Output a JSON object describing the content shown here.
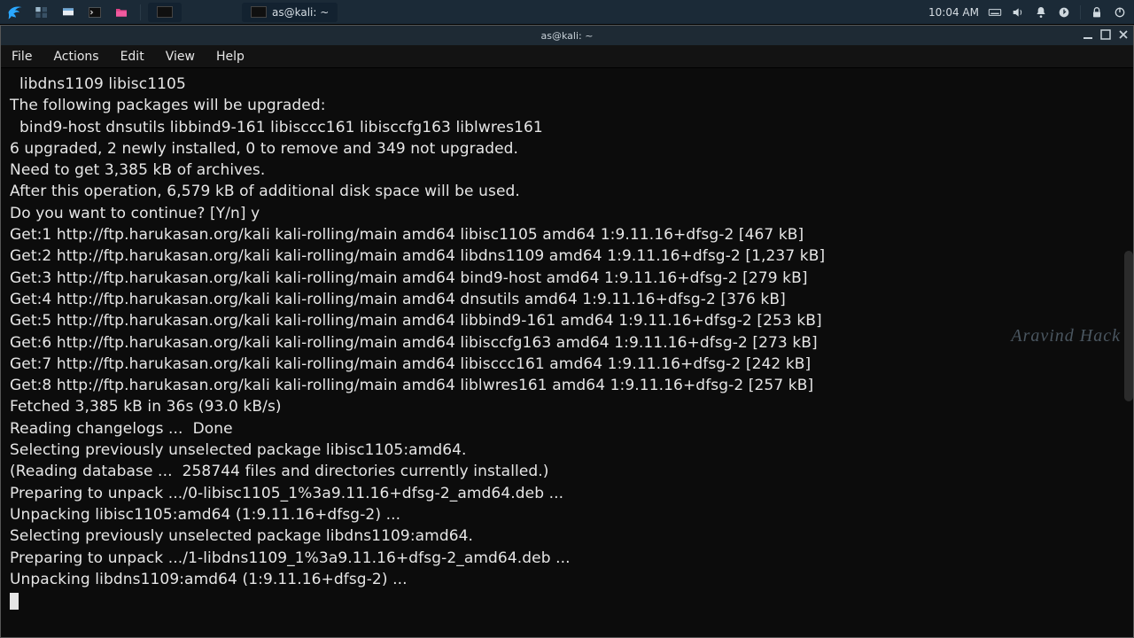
{
  "panel": {
    "taskbar": {
      "title": "as@kali: ~"
    },
    "clock": "10:04 AM"
  },
  "window": {
    "title": "as@kali: ~",
    "menus": [
      "File",
      "Actions",
      "Edit",
      "View",
      "Help"
    ]
  },
  "watermark": "Aravind Hack",
  "terminal": {
    "lines": [
      "  libdns1109 libisc1105",
      "The following packages will be upgraded:",
      "  bind9-host dnsutils libbind9-161 libisccc161 libisccfg163 liblwres161",
      "6 upgraded, 2 newly installed, 0 to remove and 349 not upgraded.",
      "Need to get 3,385 kB of archives.",
      "After this operation, 6,579 kB of additional disk space will be used.",
      "Do you want to continue? [Y/n] y",
      "Get:1 http://ftp.harukasan.org/kali kali-rolling/main amd64 libisc1105 amd64 1:9.11.16+dfsg-2 [467 kB]",
      "Get:2 http://ftp.harukasan.org/kali kali-rolling/main amd64 libdns1109 amd64 1:9.11.16+dfsg-2 [1,237 kB]",
      "Get:3 http://ftp.harukasan.org/kali kali-rolling/main amd64 bind9-host amd64 1:9.11.16+dfsg-2 [279 kB]",
      "Get:4 http://ftp.harukasan.org/kali kali-rolling/main amd64 dnsutils amd64 1:9.11.16+dfsg-2 [376 kB]",
      "Get:5 http://ftp.harukasan.org/kali kali-rolling/main amd64 libbind9-161 amd64 1:9.11.16+dfsg-2 [253 kB]",
      "Get:6 http://ftp.harukasan.org/kali kali-rolling/main amd64 libisccfg163 amd64 1:9.11.16+dfsg-2 [273 kB]",
      "Get:7 http://ftp.harukasan.org/kali kali-rolling/main amd64 libisccc161 amd64 1:9.11.16+dfsg-2 [242 kB]",
      "Get:8 http://ftp.harukasan.org/kali kali-rolling/main amd64 liblwres161 amd64 1:9.11.16+dfsg-2 [257 kB]",
      "Fetched 3,385 kB in 36s (93.0 kB/s)",
      "Reading changelogs ...  Done",
      "Selecting previously unselected package libisc1105:amd64.",
      "(Reading database ...  258744 files and directories currently installed.)",
      "Preparing to unpack .../0-libisc1105_1%3a9.11.16+dfsg-2_amd64.deb ...",
      "Unpacking libisc1105:amd64 (1:9.11.16+dfsg-2) ...",
      "Selecting previously unselected package libdns1109:amd64.",
      "Preparing to unpack .../1-libdns1109_1%3a9.11.16+dfsg-2_amd64.deb ...",
      "Unpacking libdns1109:amd64 (1:9.11.16+dfsg-2) ..."
    ]
  }
}
